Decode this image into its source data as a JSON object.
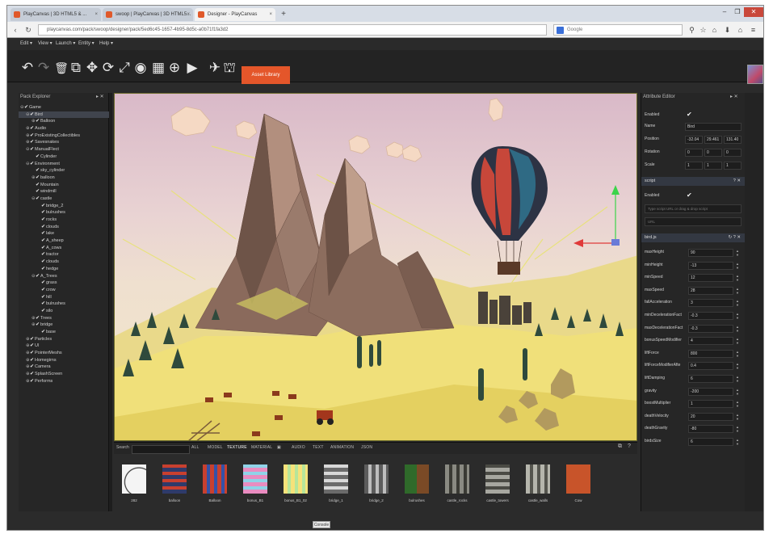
{
  "browser": {
    "tabs": [
      {
        "label": "PlayCanvas | 3D HTML5 & ...",
        "close": "×"
      },
      {
        "label": "swoop | PlayCanvas | 3D HTML5...",
        "close": "×"
      },
      {
        "label": "Designer - PlayCanvas",
        "close": "×"
      }
    ],
    "new_tab": "+",
    "url": "playcanvas.com/pack/swoop/designer/pack/5ed6c45-1657-4b95-8d5c-a0b71f1fa3d2",
    "search_placeholder": "Google",
    "window_controls": [
      "–",
      "❐",
      "✕"
    ],
    "nav_icons": [
      "back-icon",
      "refresh-icon"
    ],
    "toolbar_icons": [
      "bookmark-icon",
      "star-icon",
      "home-icon",
      "download-icon",
      "menu-icon"
    ]
  },
  "menubar": {
    "items": [
      "Edit ▾",
      "View ▾",
      "Launch ▾",
      "Entity ▾",
      "Help ▾"
    ]
  },
  "toolbar": {
    "tools": [
      "↶",
      "↷",
      "🗑",
      "⧉",
      "✥",
      "⟳",
      "⤢",
      "◉",
      "▦",
      "⊕",
      "▶",
      "✈",
      "⛫"
    ],
    "asset_library_label": "Asset Library"
  },
  "hierarchy": {
    "title": "Pack Explorer",
    "controls": "▸ ✕",
    "items": [
      {
        "label": "Game",
        "indent": 0,
        "toggle": "⊖"
      },
      {
        "label": "Bird",
        "indent": 1,
        "toggle": "⊖",
        "selected": true
      },
      {
        "label": "Balloon",
        "indent": 2,
        "toggle": "⊕"
      },
      {
        "label": "Audio",
        "indent": 1,
        "toggle": "⊕"
      },
      {
        "label": "ProExistingCollectibles",
        "indent": 1,
        "toggle": "⊕"
      },
      {
        "label": "Savesnakes",
        "indent": 1,
        "toggle": "⊕"
      },
      {
        "label": "ManualFlect",
        "indent": 1,
        "toggle": "⊖"
      },
      {
        "label": "Cylinder",
        "indent": 2,
        "toggle": ""
      },
      {
        "label": "Environment",
        "indent": 1,
        "toggle": "⊖"
      },
      {
        "label": "sky_cylinder",
        "indent": 2,
        "toggle": ""
      },
      {
        "label": "balloon",
        "indent": 2,
        "toggle": "⊕"
      },
      {
        "label": "Mountain",
        "indent": 2,
        "toggle": ""
      },
      {
        "label": "windmill",
        "indent": 2,
        "toggle": ""
      },
      {
        "label": "castle",
        "indent": 2,
        "toggle": "⊖"
      },
      {
        "label": "bridge_2",
        "indent": 3,
        "toggle": ""
      },
      {
        "label": "bulrushes",
        "indent": 3,
        "toggle": ""
      },
      {
        "label": "rocks",
        "indent": 3,
        "toggle": ""
      },
      {
        "label": "clouds",
        "indent": 3,
        "toggle": ""
      },
      {
        "label": "lake",
        "indent": 3,
        "toggle": ""
      },
      {
        "label": "A_sheep",
        "indent": 3,
        "toggle": ""
      },
      {
        "label": "A_cows",
        "indent": 3,
        "toggle": ""
      },
      {
        "label": "tractor",
        "indent": 3,
        "toggle": ""
      },
      {
        "label": "clouds",
        "indent": 3,
        "toggle": ""
      },
      {
        "label": "hedge",
        "indent": 3,
        "toggle": ""
      },
      {
        "label": "A_Trees",
        "indent": 2,
        "toggle": "⊖"
      },
      {
        "label": "grass",
        "indent": 3,
        "toggle": ""
      },
      {
        "label": "crow",
        "indent": 3,
        "toggle": ""
      },
      {
        "label": "hill",
        "indent": 3,
        "toggle": ""
      },
      {
        "label": "bulrushes",
        "indent": 3,
        "toggle": ""
      },
      {
        "label": "silo",
        "indent": 3,
        "toggle": ""
      },
      {
        "label": "Trees",
        "indent": 2,
        "toggle": "⊕"
      },
      {
        "label": "bridge",
        "indent": 2,
        "toggle": "⊕"
      },
      {
        "label": "base",
        "indent": 3,
        "toggle": ""
      },
      {
        "label": "Particles",
        "indent": 1,
        "toggle": "⊕"
      },
      {
        "label": "UI",
        "indent": 1,
        "toggle": "⊕"
      },
      {
        "label": "PointerMeshs",
        "indent": 1,
        "toggle": "⊕"
      },
      {
        "label": "Homegirns",
        "indent": 1,
        "toggle": "⊕"
      },
      {
        "label": "Camera",
        "indent": 1,
        "toggle": "⊕"
      },
      {
        "label": "SplashScreen",
        "indent": 1,
        "toggle": "⊕"
      },
      {
        "label": "Performs",
        "indent": 1,
        "toggle": "⊕"
      }
    ]
  },
  "assets": {
    "search_label": "Search",
    "filters": [
      "ALL",
      "MODEL",
      "TEXTURE",
      "MATERIAL",
      "▣",
      "AUDIO",
      "TEXT",
      "ANIMATION",
      "JSON"
    ],
    "active_filter": "TEXTURE",
    "panel_icons": [
      "⧉",
      "?"
    ],
    "items": [
      {
        "name": "282",
        "color1": "#f4f4f4",
        "color2": "#1a1a1a"
      },
      {
        "name": "balloon",
        "color1": "#2f3a6a",
        "color2": "#c8402f"
      },
      {
        "name": "Balloon",
        "color1": "#c8402f",
        "color2": "#3452a8"
      },
      {
        "name": "bonus_B1",
        "color1": "#e98cc0",
        "color2": "#8fd3e8"
      },
      {
        "name": "bonus_B1_02",
        "color1": "#f6e27a",
        "color2": "#b7e59a"
      },
      {
        "name": "bridge_1",
        "color1": "#6b6b6b",
        "color2": "#d8d8d8"
      },
      {
        "name": "bridge_2",
        "color1": "#5c5c5c",
        "color2": "#bdbdbd"
      },
      {
        "name": "bulrushes",
        "color1": "#2f6a2a",
        "color2": "#7a4a26"
      },
      {
        "name": "castle_rocks",
        "color1": "#8a8a82",
        "color2": "#3a3a34"
      },
      {
        "name": "castle_towers",
        "color1": "#a7a7a0",
        "color2": "#4a4a44"
      },
      {
        "name": "castle_walls",
        "color1": "#b5b5ac",
        "color2": "#55554e"
      },
      {
        "name": "Cow",
        "color1": "#c8542a",
        "color2": "#8e3a1c"
      }
    ]
  },
  "attributes": {
    "title": "Attribute Editor",
    "controls": "▸ ✕",
    "entity": {
      "enabled_label": "Enabled",
      "enabled": "✔",
      "name_label": "Name",
      "name_value": "Bird",
      "position_label": "Position",
      "position": [
        "-32.04",
        "29.461",
        "131.40"
      ],
      "rotation_label": "Rotation",
      "rotation": [
        "0",
        "0",
        "0"
      ],
      "scale_label": "Scale",
      "scale": [
        "1",
        "1",
        "1"
      ]
    },
    "script_section": {
      "title": "script",
      "controls": "? ✕",
      "enabled_label": "Enabled",
      "enabled": "✔",
      "url_placeholder": "Type script URL or drag & drop script",
      "url_hint": "URL"
    },
    "bird_section": {
      "title": "bird.js",
      "controls": "↻ ? ✕",
      "params": [
        {
          "label": "maxHeight",
          "value": "90"
        },
        {
          "label": "minHeight",
          "value": "-13"
        },
        {
          "label": "minSpeed",
          "value": "12"
        },
        {
          "label": "maxSpeed",
          "value": "28"
        },
        {
          "label": "fallAcceleration",
          "value": "3"
        },
        {
          "label": "minDecelerationFact",
          "value": "-0.3"
        },
        {
          "label": "maxDecelerationFact",
          "value": "-0.3"
        },
        {
          "label": "bonusSpeedModifier",
          "value": "4"
        },
        {
          "label": "liftForce",
          "value": "800"
        },
        {
          "label": "liftForceModifierAfte",
          "value": "0.4"
        },
        {
          "label": "liftDamping",
          "value": "6"
        },
        {
          "label": "gravity",
          "value": "-200"
        },
        {
          "label": "boostMultiplier",
          "value": "1"
        },
        {
          "label": "deathVelocity",
          "value": "20"
        },
        {
          "label": "deathGravity",
          "value": "-80"
        },
        {
          "label": "birdsSize",
          "value": "6"
        }
      ]
    }
  },
  "statusbar": {
    "console_label": "Console"
  }
}
